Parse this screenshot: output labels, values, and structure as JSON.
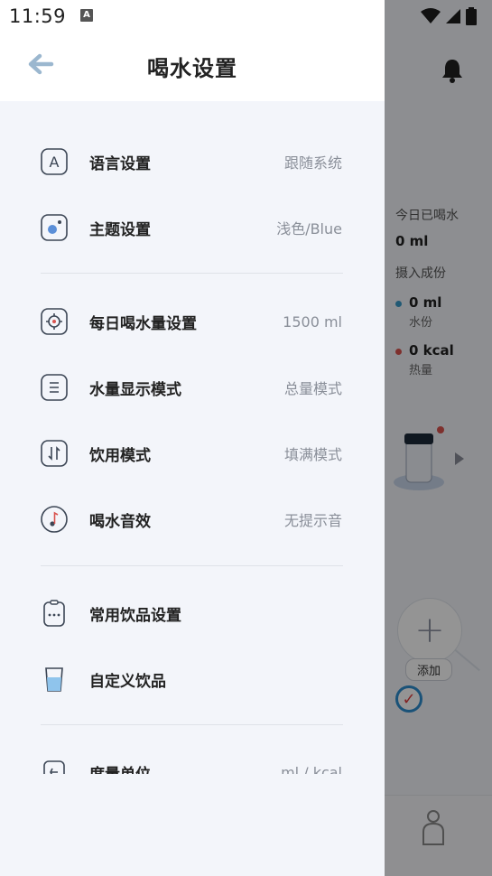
{
  "status_bar": {
    "time": "11:59",
    "notif_icon": "A"
  },
  "drawer": {
    "title": "喝水设置",
    "groups": [
      [
        {
          "icon": "language-icon",
          "label": "语言设置",
          "value": "跟随系统"
        },
        {
          "icon": "theme-icon",
          "label": "主题设置",
          "value": "浅色/Blue"
        }
      ],
      [
        {
          "icon": "target-icon",
          "label": "每日喝水量设置",
          "value": "1500 ml"
        },
        {
          "icon": "list-icon",
          "label": "水量显示模式",
          "value": "总量模式"
        },
        {
          "icon": "swap-icon",
          "label": "饮用模式",
          "value": "填满模式"
        },
        {
          "icon": "music-note-icon",
          "label": "喝水音效",
          "value": "无提示音"
        }
      ],
      [
        {
          "icon": "clipboard-icon",
          "label": "常用饮品设置",
          "value": ""
        },
        {
          "icon": "cup-icon",
          "label": "自定义饮品",
          "value": ""
        }
      ],
      [
        {
          "icon": "unit-icon",
          "label": "度量单位",
          "value": "ml / kcal"
        }
      ]
    ]
  },
  "background": {
    "today_label": "今日已喝水",
    "today_value": "0 ml",
    "intake_label": "摄入成份",
    "water_value": "0 ml",
    "water_label": "水份",
    "calorie_value": "0 kcal",
    "calorie_label": "热量",
    "add_label": "添加"
  },
  "colors": {
    "accent": "#2d8ecf",
    "water_dot": "#3a9ac9",
    "calorie_dot": "#d9534f"
  }
}
